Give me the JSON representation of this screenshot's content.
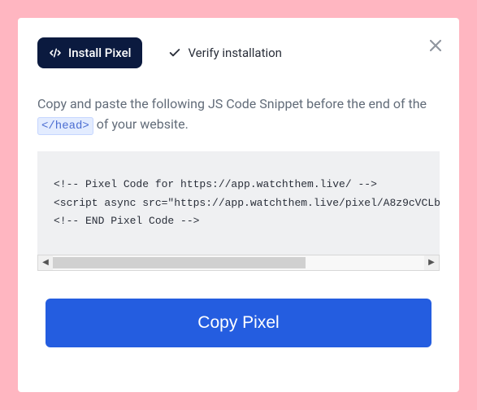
{
  "tabs": {
    "install_label": "Install Pixel",
    "verify_label": "Verify installation"
  },
  "instructions": {
    "before": "Copy and paste the following JS Code Snippet before the end of the ",
    "head_tag": "</head>",
    "after": " of your website."
  },
  "code_snippet": "<!-- Pixel Code for https://app.watchthem.live/ -->\n<script async src=\"https://app.watchthem.live/pixel/A8z9cVCLb\n<!-- END Pixel Code -->",
  "buttons": {
    "copy_label": "Copy Pixel"
  }
}
